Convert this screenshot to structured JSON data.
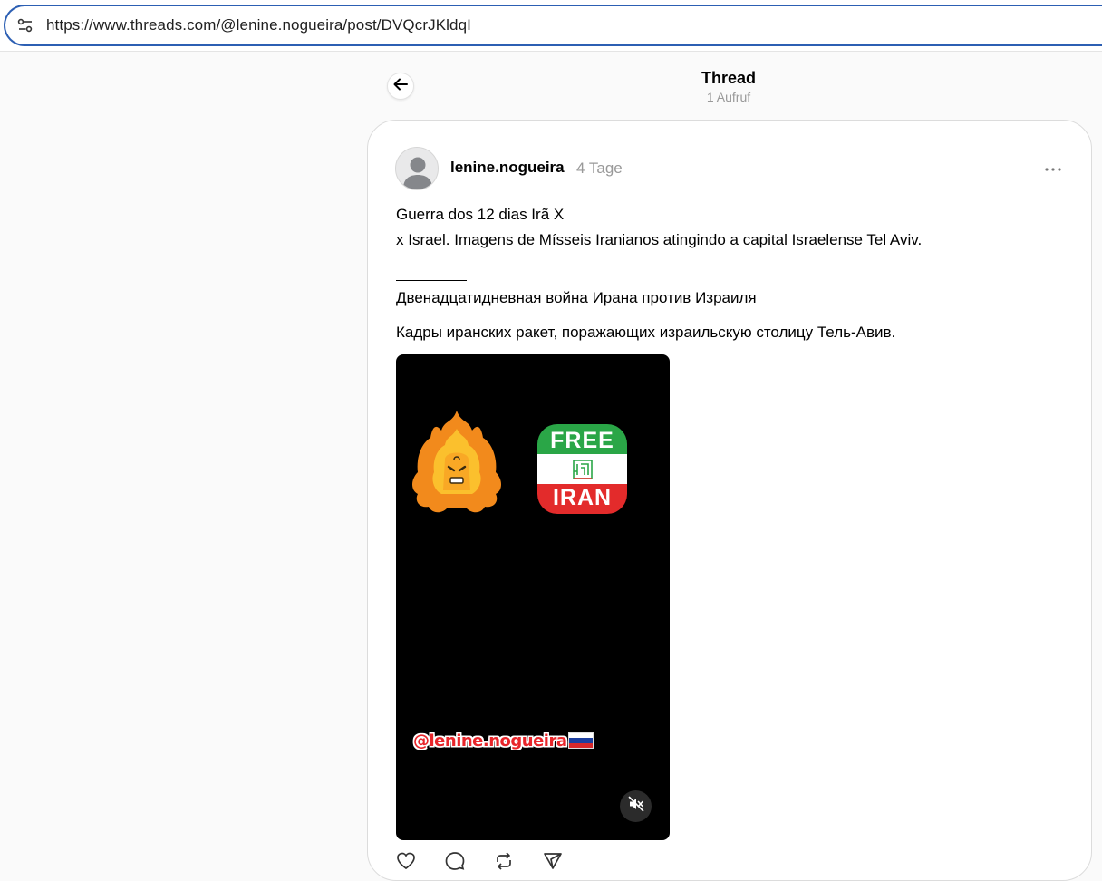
{
  "browser": {
    "url": "https://www.threads.com/@lenine.nogueira/post/DVQcrJKldqI",
    "accent_color": "#2c5fb3"
  },
  "header": {
    "title": "Thread",
    "views": "1 Aufruf"
  },
  "post": {
    "username": "lenine.nogueira",
    "time": "4 Tage",
    "lines": [
      "Guerra dos 12 dias Irã X",
      "x Israel. Imagens de Mísseis Iranianos atingindo a capital Israelense Tel Aviv.",
      "Двенадцатидневная война Ирана против Израиля",
      "Кадры иранских ракет, поражающих израильскую столицу Тель-Авив."
    ],
    "video": {
      "sticker_top": "FREE",
      "sticker_bottom": "IRAN",
      "watermark": "@lenine.nogueira",
      "muted": true
    }
  },
  "icons": {
    "site_info": "tune-icon",
    "back": "arrow-left-icon",
    "more": "more-horizontal-icon",
    "mute": "volume-off-icon",
    "actions": [
      "heart-icon",
      "comment-icon",
      "repost-icon",
      "share-icon"
    ]
  }
}
